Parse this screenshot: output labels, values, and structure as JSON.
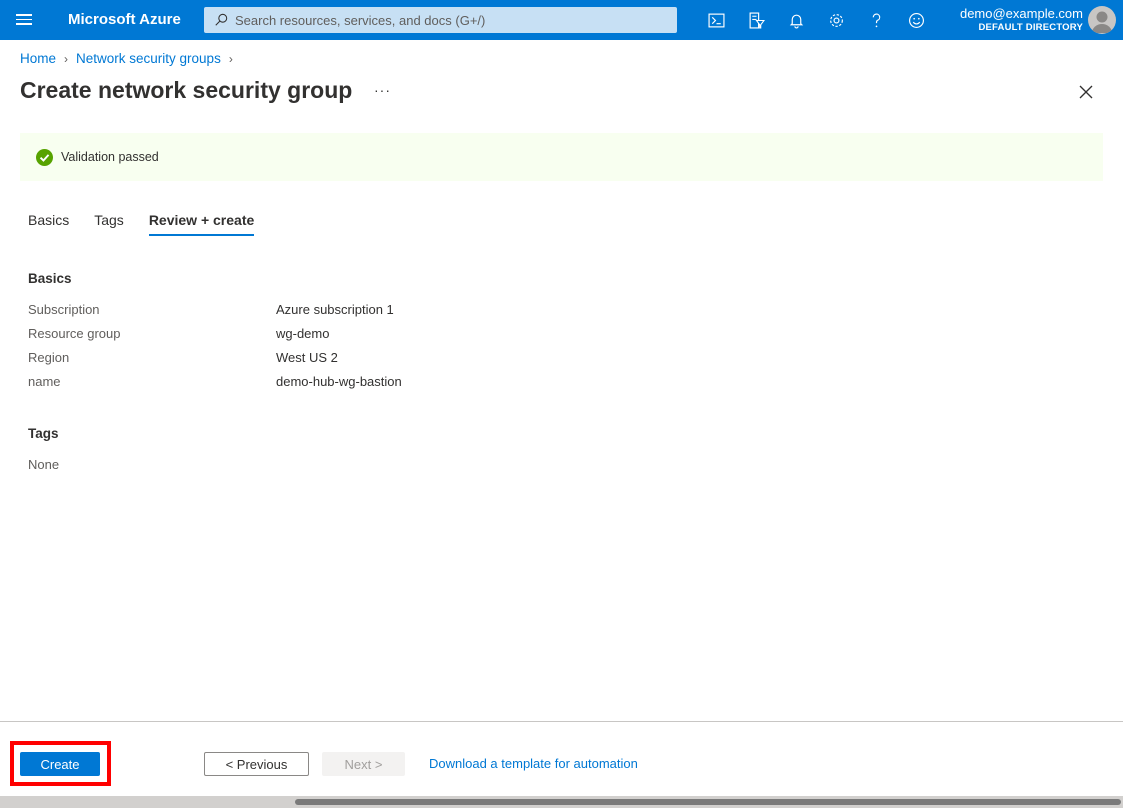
{
  "topbar": {
    "brand": "Microsoft Azure",
    "search_placeholder": "Search resources, services, and docs (G+/)",
    "search_value": "",
    "icons": [
      "cloud-shell-icon",
      "directory-filter-icon",
      "notifications-icon",
      "settings-icon",
      "help-icon",
      "feedback-icon"
    ],
    "account_email": "demo@example.com",
    "account_directory": "DEFAULT DIRECTORY"
  },
  "breadcrumb": [
    {
      "label": "Home"
    },
    {
      "label": "Network security groups"
    }
  ],
  "page": {
    "title": "Create network security group",
    "more_label": "···"
  },
  "banner": {
    "text": "Validation passed",
    "status": "success",
    "color": "#57a300"
  },
  "tabs": [
    {
      "label": "Basics",
      "active": false
    },
    {
      "label": "Tags",
      "active": false
    },
    {
      "label": "Review + create",
      "active": true
    }
  ],
  "review": {
    "basics_title": "Basics",
    "basics": [
      {
        "label": "Subscription",
        "value": "Azure subscription 1"
      },
      {
        "label": "Resource group",
        "value": "wg-demo"
      },
      {
        "label": "Region",
        "value": "West US 2"
      },
      {
        "label": "name",
        "value": "demo-hub-wg-bastion"
      }
    ],
    "tags_title": "Tags",
    "tags_value": "None"
  },
  "footer": {
    "create_label": "Create",
    "previous_label": "< Previous",
    "next_label": "Next >",
    "download_link": "Download a template for automation"
  },
  "colors": {
    "accent": "#0078d4",
    "highlight": "#ff0000",
    "banner_bg": "#f8fff0"
  }
}
